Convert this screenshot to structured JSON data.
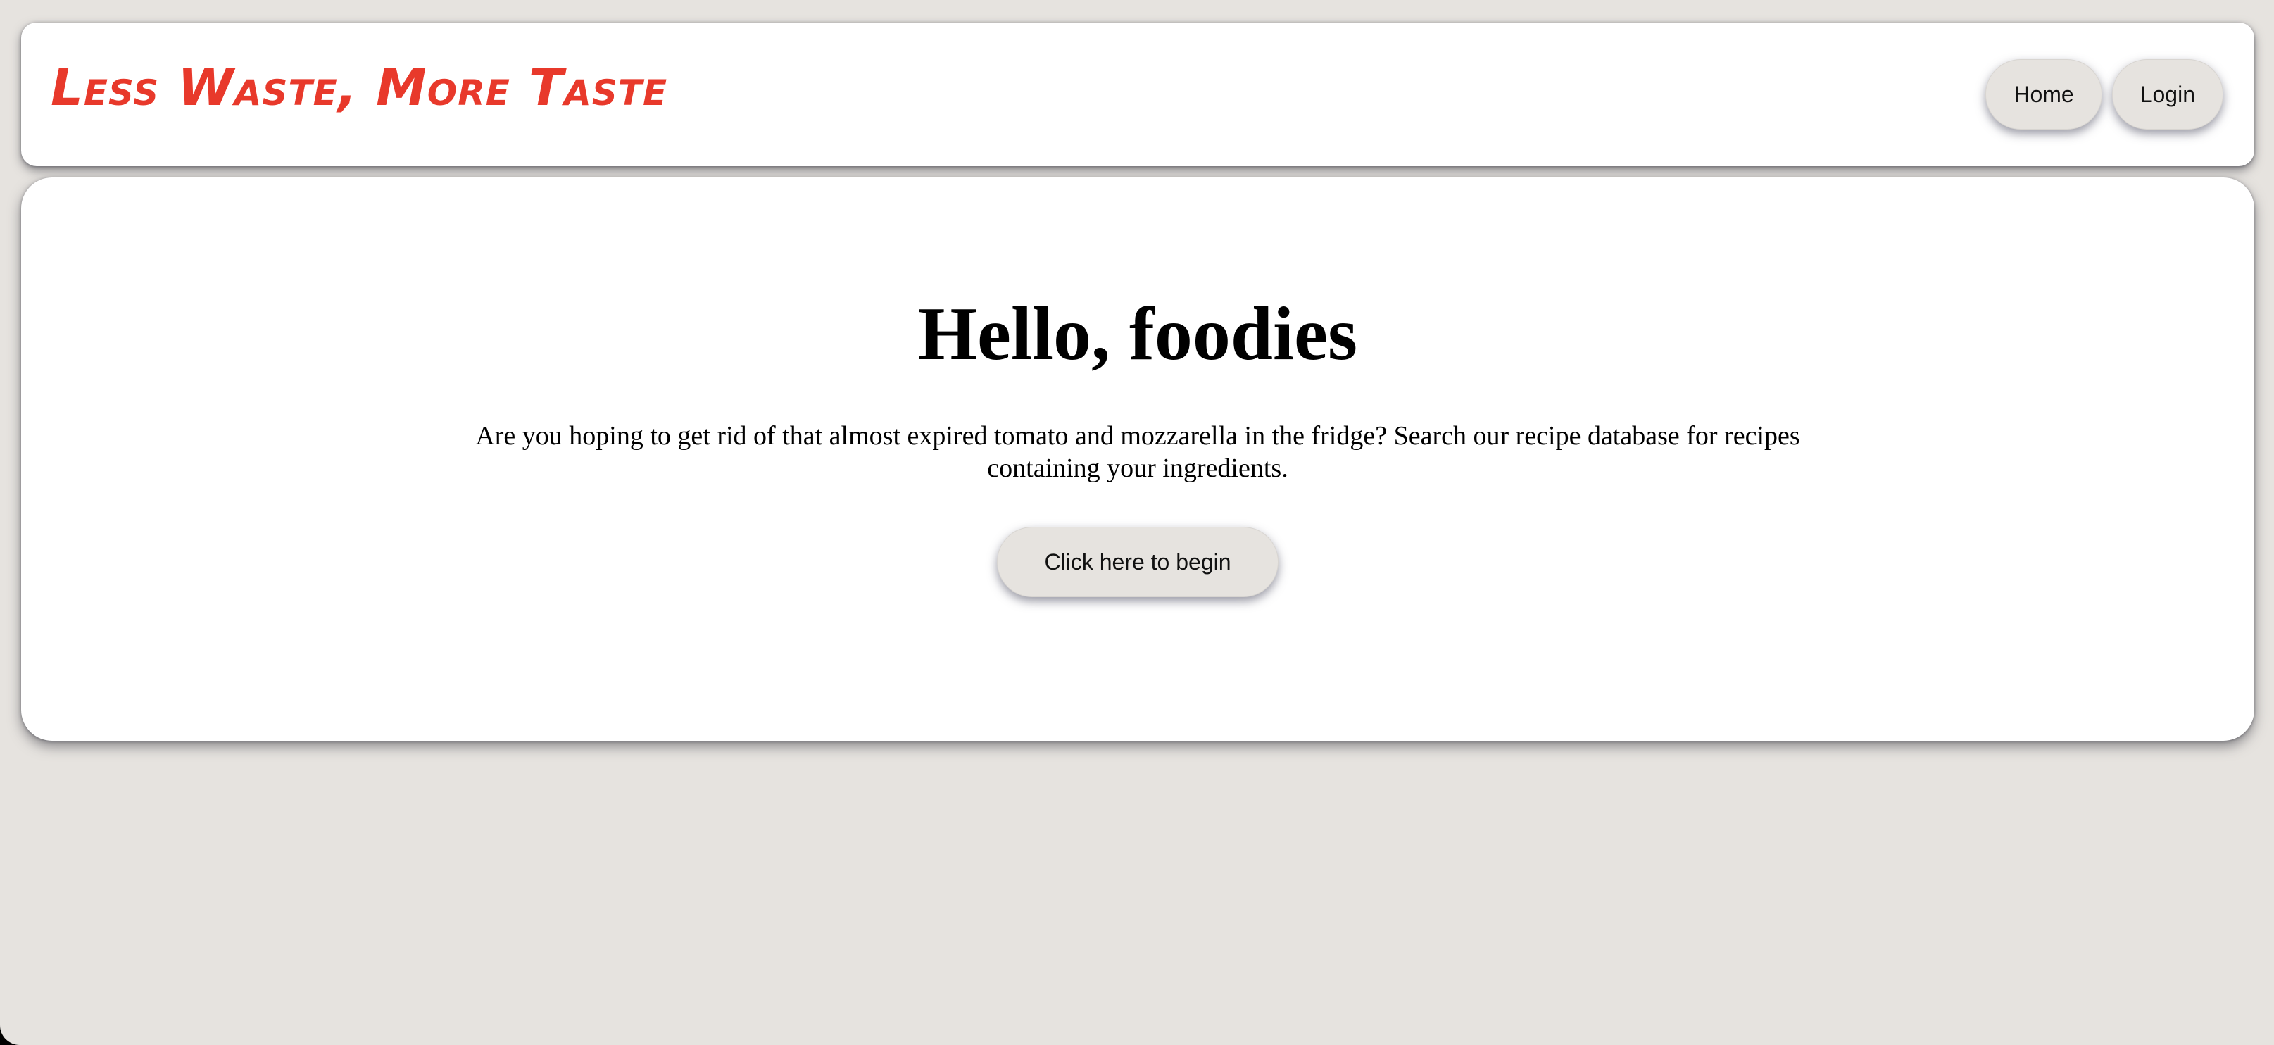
{
  "header": {
    "brand": "Less Waste, More Taste",
    "nav": {
      "home_label": "Home",
      "login_label": "Login"
    }
  },
  "hero": {
    "title": "Hello, foodies",
    "description": "Are you hoping to get rid of that almost expired tomato and mozzarella in the fridge? Search our recipe database for recipes containing your ingredients.",
    "cta_label": "Click here to begin"
  },
  "colors": {
    "background": "#e6e3df",
    "card": "#ffffff",
    "brand": "#e8392b",
    "button": "#e6e3df"
  }
}
